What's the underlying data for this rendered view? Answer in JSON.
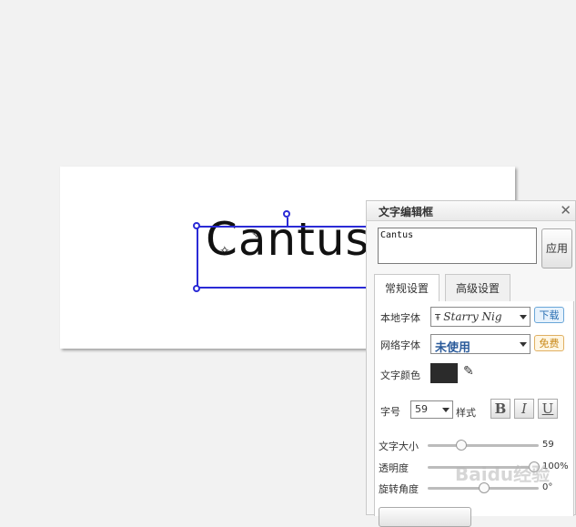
{
  "canvas": {
    "text": "Cantus"
  },
  "panel": {
    "title": "文字编辑框",
    "text_value": "Cantus",
    "apply_label": "应用",
    "tabs": [
      {
        "label": "常规设置"
      },
      {
        "label": "高级设置"
      }
    ],
    "local_font": {
      "label": "本地字体",
      "value": "Starry Nig",
      "badge": "下载"
    },
    "web_font": {
      "label": "网络字体",
      "value": "未使用",
      "badge": "免费"
    },
    "text_color": {
      "label": "文字颜色",
      "color": "#2b2b2b"
    },
    "font_size": {
      "label": "字号",
      "value": "59",
      "style_label": "样式",
      "bold": "B",
      "italic": "I",
      "underline": "U"
    },
    "sliders": [
      {
        "label": "文字大小",
        "value_text": "59",
        "fraction": 0.3
      },
      {
        "label": "透明度",
        "value_text": "100%",
        "fraction": 1.0
      },
      {
        "label": "旋转角度",
        "value_text": "0°",
        "fraction": 0.5
      }
    ]
  },
  "watermark": "Baidu经验"
}
